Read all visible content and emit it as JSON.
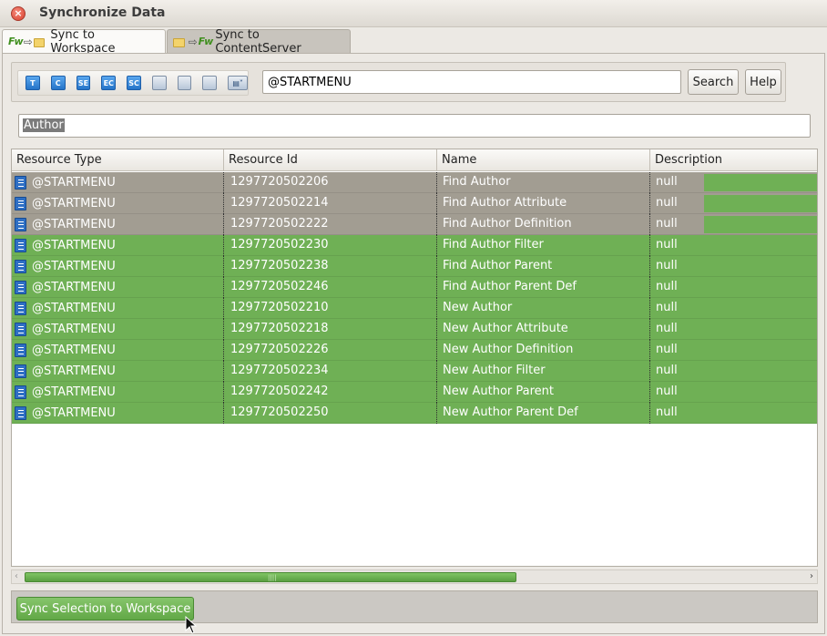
{
  "window": {
    "title": "Synchronize Data",
    "close_icon": "close-icon"
  },
  "tabs": [
    {
      "label": "Sync to Workspace",
      "icons": [
        "fw-logo-icon",
        "arrow-right-icon",
        "folder-icon"
      ],
      "active": true
    },
    {
      "label": "Sync to ContentServer",
      "icons": [
        "folder-icon",
        "arrow-right-icon",
        "fw-logo-icon"
      ],
      "active": false
    }
  ],
  "toolbar": {
    "icons": [
      {
        "name": "template-icon",
        "glyph": "T"
      },
      {
        "name": "cs-element-icon",
        "glyph": "C"
      },
      {
        "name": "site-entry-icon",
        "glyph": "SE"
      },
      {
        "name": "element-catalog-icon",
        "glyph": "EC"
      },
      {
        "name": "site-catalog-icon",
        "glyph": "SC"
      },
      {
        "name": "refresh-icon",
        "glyph": ""
      },
      {
        "name": "users-icon",
        "glyph": ""
      },
      {
        "name": "start-menu-icon",
        "glyph": ""
      },
      {
        "name": "more-dropdown-icon",
        "glyph": ""
      }
    ],
    "search_value": "@STARTMENU",
    "search_label": "Search",
    "help_label": "Help"
  },
  "filter": {
    "value": "Author"
  },
  "table": {
    "columns": [
      "Resource Type",
      "Resource Id",
      "Name",
      "Description"
    ],
    "rows": [
      {
        "type": "@STARTMENU",
        "id": "1297720502206",
        "name": "Find Author",
        "desc": "null",
        "selected": true
      },
      {
        "type": "@STARTMENU",
        "id": "1297720502214",
        "name": "Find Author Attribute",
        "desc": "null",
        "selected": true
      },
      {
        "type": "@STARTMENU",
        "id": "1297720502222",
        "name": "Find Author Definition",
        "desc": "null",
        "selected": true
      },
      {
        "type": "@STARTMENU",
        "id": "1297720502230",
        "name": "Find Author Filter",
        "desc": "null",
        "selected": false
      },
      {
        "type": "@STARTMENU",
        "id": "1297720502238",
        "name": "Find Author Parent",
        "desc": "null",
        "selected": false
      },
      {
        "type": "@STARTMENU",
        "id": "1297720502246",
        "name": "Find Author Parent Def",
        "desc": "null",
        "selected": false
      },
      {
        "type": "@STARTMENU",
        "id": "1297720502210",
        "name": "New Author",
        "desc": "null",
        "selected": false
      },
      {
        "type": "@STARTMENU",
        "id": "1297720502218",
        "name": "New Author Attribute",
        "desc": "null",
        "selected": false
      },
      {
        "type": "@STARTMENU",
        "id": "1297720502226",
        "name": "New Author Definition",
        "desc": "null",
        "selected": false
      },
      {
        "type": "@STARTMENU",
        "id": "1297720502234",
        "name": "New Author Filter",
        "desc": "null",
        "selected": false
      },
      {
        "type": "@STARTMENU",
        "id": "1297720502242",
        "name": "New Author Parent",
        "desc": "null",
        "selected": false
      },
      {
        "type": "@STARTMENU",
        "id": "1297720502250",
        "name": "New Author Parent Def",
        "desc": "null",
        "selected": false
      }
    ]
  },
  "footer": {
    "sync_button_label": "Sync Selection to Workspace"
  },
  "colors": {
    "row_green": "#6fb055",
    "row_selected": "#a29d92",
    "accent": "#62a847"
  }
}
